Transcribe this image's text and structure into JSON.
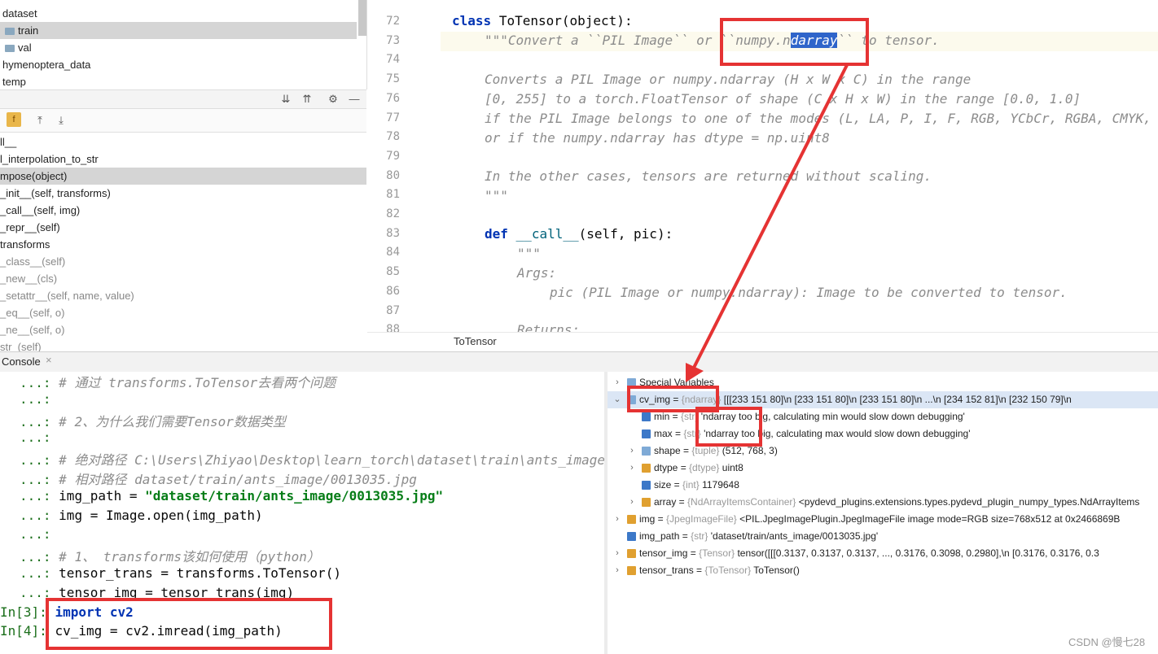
{
  "project_tree": {
    "items": [
      {
        "label": "dataset",
        "indent": 0,
        "folder": false
      },
      {
        "label": "train",
        "indent": 1,
        "folder": true,
        "selected": true
      },
      {
        "label": "val",
        "indent": 1,
        "folder": true
      },
      {
        "label": "hymenoptera_data",
        "indent": 0,
        "folder": false
      },
      {
        "label": "temp",
        "indent": 0,
        "folder": false
      }
    ]
  },
  "structure": {
    "f_badge": "f",
    "items": [
      {
        "label": "ll__",
        "dim": false
      },
      {
        "label": "l_interpolation_to_str",
        "dim": false
      },
      {
        "label": "mpose(object)",
        "dim": false,
        "selected": true
      },
      {
        "label": "_init__(self, transforms)",
        "dim": false
      },
      {
        "label": "_call__(self, img)",
        "dim": false
      },
      {
        "label": "_repr__(self)",
        "dim": false
      },
      {
        "label": "transforms",
        "dim": false
      },
      {
        "label": "_class__(self)",
        "dim": true
      },
      {
        "label": "_new__(cls)",
        "dim": true
      },
      {
        "label": "_setattr__(self, name, value)",
        "dim": true
      },
      {
        "label": "_eq__(self, o)",
        "dim": true
      },
      {
        "label": "_ne__(self, o)",
        "dim": true
      },
      {
        "label": "str_(self)",
        "dim": true
      }
    ]
  },
  "editor": {
    "line_numbers": [
      "72",
      "73",
      "74",
      "75",
      "76",
      "77",
      "78",
      "79",
      "80",
      "81",
      "82",
      "83",
      "84",
      "85",
      "86",
      "87",
      "88"
    ],
    "class_kw": "class",
    "class_sig": "ToTensor(object):",
    "doc_open": "\"\"\"Convert a ``PIL Image`` or ``numpy.n",
    "doc_selected": "darray",
    "doc_rest": "`` to tensor.",
    "doc_lines": [
      "Converts a PIL Image or numpy.ndarray (H x W x C) in the range",
      "[0, 255] to a torch.FloatTensor of shape (C x H x W) in the range [0.0, 1.0]",
      "if the PIL Image belongs to one of the modes (L, LA, P, I, F, RGB, YCbCr, RGBA, CMYK, 1)",
      "or if the numpy.ndarray has dtype = np.uint8",
      "In the other cases, tensors are returned without scaling.",
      "\"\"\""
    ],
    "def_kw": "def",
    "def_name": "__call__",
    "def_sig": "(self, pic):",
    "doc2_open": "\"\"\"",
    "doc2_args": "Args:",
    "doc2_pic": "pic (PIL Image or numpy.ndarray): Image to be converted to tensor.",
    "doc2_returns": "Returns:",
    "breadcrumb": "ToTensor"
  },
  "console": {
    "tab_label": "Console",
    "close_label": "×",
    "lines": [
      {
        "prompt": "...: ",
        "text": "# 通过 transforms.ToTensor去看两个问题",
        "kind": "comment"
      },
      {
        "prompt": "...: ",
        "text": "",
        "kind": "plain"
      },
      {
        "prompt": "...: ",
        "text": "# 2、为什么我们需要Tensor数据类型",
        "kind": "comment"
      },
      {
        "prompt": "...: ",
        "text": "",
        "kind": "plain"
      },
      {
        "prompt": "...: ",
        "text": "# 绝对路径 C:\\Users\\Zhiyao\\Desktop\\learn_torch\\dataset\\train\\ants_image",
        "kind": "comment"
      },
      {
        "prompt": "...: ",
        "text": "# 相对路径 dataset/train/ants_image/0013035.jpg",
        "kind": "comment"
      },
      {
        "prompt": "...: ",
        "text": "img_path = ",
        "kind": "assign_str",
        "str": "\"dataset/train/ants_image/0013035.jpg\""
      },
      {
        "prompt": "...: ",
        "text": "img = Image.open(img_path)",
        "kind": "plain"
      },
      {
        "prompt": "...: ",
        "text": "",
        "kind": "plain"
      },
      {
        "prompt": "...: ",
        "text": "# 1、 transforms该如何使用（python）",
        "kind": "comment"
      },
      {
        "prompt": "...: ",
        "text": "tensor_trans = transforms.ToTensor()",
        "kind": "plain"
      },
      {
        "prompt": "...: ",
        "text": "tensor_img = tensor_trans(img)",
        "kind": "plain"
      },
      {
        "prompt": "In[3]: ",
        "text": "import cv2",
        "kind": "import"
      },
      {
        "prompt": "In[4]: ",
        "text": "cv_img = cv2.imread(img_path)",
        "kind": "plain"
      }
    ]
  },
  "variables": {
    "rows": [
      {
        "arrow": "›",
        "icon": "list",
        "name": "Special Variables",
        "type": "",
        "value": "",
        "level": 0
      },
      {
        "arrow": "⌄",
        "icon": "list",
        "name": "cv_img",
        "type": "{ndarray}",
        "value": "[[[233 151  80]\\n  [233 151  80]\\n  [233 151  80]\\n  ...\\n  [234 152  81]\\n  [232 150  79]\\n",
        "level": 0,
        "selected": true
      },
      {
        "arrow": "",
        "icon": "obj",
        "name": "min",
        "type": "{str}",
        "value": "'ndarray too big, calculating min would slow down debugging'",
        "level": 1
      },
      {
        "arrow": "",
        "icon": "obj",
        "name": "max",
        "type": "{str}",
        "value": "'ndarray too big, calculating max would slow down debugging'",
        "level": 1
      },
      {
        "arrow": "›",
        "icon": "list",
        "name": "shape",
        "type": "{tuple}",
        "value": "(512, 768, 3)",
        "level": 1
      },
      {
        "arrow": "›",
        "icon": "bar",
        "name": "dtype",
        "type": "{dtype}",
        "value": "uint8",
        "level": 1
      },
      {
        "arrow": "",
        "icon": "obj",
        "name": "size",
        "type": "{int}",
        "value": "1179648",
        "level": 1
      },
      {
        "arrow": "›",
        "icon": "bar",
        "name": "array",
        "type": "{NdArrayItemsContainer}",
        "value": "<pydevd_plugins.extensions.types.pydevd_plugin_numpy_types.NdArrayItems",
        "level": 1
      },
      {
        "arrow": "›",
        "icon": "bar",
        "name": "img",
        "type": "{JpegImageFile}",
        "value": "<PIL.JpegImagePlugin.JpegImageFile image mode=RGB size=768x512 at 0x2466869B",
        "level": 0
      },
      {
        "arrow": "",
        "icon": "obj",
        "name": "img_path",
        "type": "{str}",
        "value": "'dataset/train/ants_image/0013035.jpg'",
        "level": 0
      },
      {
        "arrow": "›",
        "icon": "bar",
        "name": "tensor_img",
        "type": "{Tensor}",
        "value": "tensor([[[0.3137, 0.3137, 0.3137,  ..., 0.3176, 0.3098, 0.2980],\\n         [0.3176, 0.3176, 0.3",
        "level": 0
      },
      {
        "arrow": "›",
        "icon": "bar",
        "name": "tensor_trans",
        "type": "{ToTensor}",
        "value": "ToTensor()",
        "level": 0
      }
    ]
  },
  "watermark": "CSDN @慢七28",
  "colors": {
    "annotation": "#e53333",
    "selection": "#2f65ca"
  }
}
